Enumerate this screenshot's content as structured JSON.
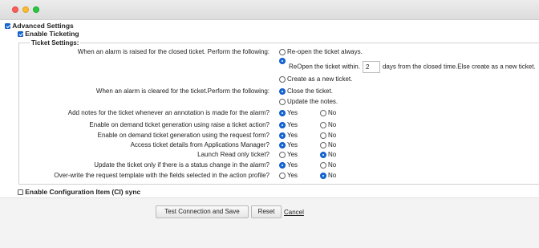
{
  "advanced_settings": {
    "label": "Advanced Settings",
    "checked": true
  },
  "enable_ticketing": {
    "label": "Enable Ticketing",
    "checked": true
  },
  "ticket_settings": {
    "legend": "Ticket Settings:",
    "alarm_raised": {
      "label": "When an alarm is raised for the closed ticket. Perform the following:",
      "reopen_always": "Re-open the ticket always.",
      "reopen_within_prefix": "ReOpen the ticket within.",
      "reopen_days_value": "2",
      "reopen_within_suffix": "days from the closed time.Else create as a new ticket.",
      "create_new": "Create as a new ticket.",
      "selected": "reopen_within"
    },
    "alarm_cleared": {
      "label": "When an alarm is cleared for the ticket.Perform the following:",
      "close_ticket": "Close the ticket.",
      "update_notes": "Update the notes.",
      "selected": "close_ticket"
    },
    "yes_label": "Yes",
    "no_label": "No",
    "rows": [
      {
        "label": "Add notes for the ticket whenever an annotation is made for the alarm?",
        "selected": "yes"
      },
      {
        "label": "Enable on demand ticket generation using raise a ticket action?",
        "selected": "yes"
      },
      {
        "label": "Enable on demand ticket generation using the request form?",
        "selected": "yes"
      },
      {
        "label": "Access ticket details from Applications Manager?",
        "selected": "yes"
      },
      {
        "label": "Launch Read only ticket?",
        "selected": "no"
      },
      {
        "label": "Update the ticket only if there is a status change in the alarm?",
        "selected": "yes"
      },
      {
        "label": "Over-write the request template with the fields selected in the action profile?",
        "selected": "no"
      }
    ]
  },
  "enable_ci_sync": {
    "label": "Enable Configuration Item (CI) sync",
    "checked": false
  },
  "footer": {
    "test_connection_label": "Test Connection and Save",
    "reset_label": "Reset",
    "cancel_label": "Cancel"
  }
}
